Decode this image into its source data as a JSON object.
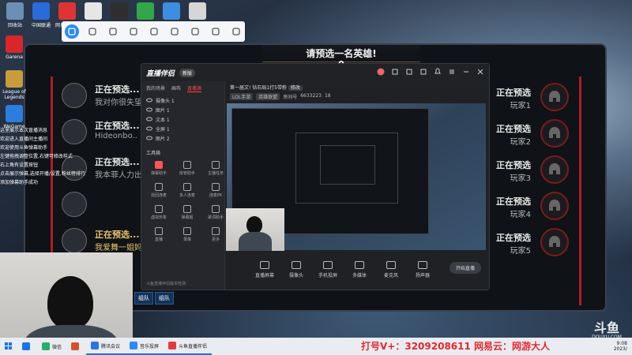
{
  "desktop": {
    "icons_top": [
      {
        "label": "回收站",
        "color": "#6b8fb5"
      },
      {
        "label": "中国联通",
        "color": "#2a6ad9"
      },
      {
        "label": "网易云音乐",
        "color": "#e03434"
      },
      {
        "label": "",
        "color": "#e6e6e6"
      },
      {
        "label": "",
        "color": "#2e2e2e"
      },
      {
        "label": "",
        "color": "#33a64a"
      },
      {
        "label": "",
        "color": "#3b8ee0"
      },
      {
        "label": "",
        "color": "#d6d6d6"
      }
    ],
    "icons_left": [
      {
        "label": "Garena",
        "color": "#d8262b"
      },
      {
        "label": "League of Legends",
        "color": "#c89b3c"
      },
      {
        "label": "WeGame",
        "color": "#2b7de0"
      }
    ]
  },
  "toolbar": {
    "buttons": [
      {
        "name": "user-icon",
        "active": true
      },
      {
        "name": "fullscreen-icon",
        "active": false
      },
      {
        "name": "camera-icon",
        "active": false
      },
      {
        "name": "screenshot-icon",
        "active": false
      },
      {
        "name": "screen-icon",
        "active": false
      },
      {
        "name": "brush-icon",
        "active": false
      },
      {
        "name": "grid-icon",
        "active": false
      },
      {
        "name": "gear-icon",
        "active": false
      },
      {
        "name": "headset-icon",
        "active": false
      }
    ]
  },
  "game": {
    "title": "请预选一名英雄!",
    "timer": "0",
    "left_team": [
      {
        "status": "正在预选...",
        "name": "我对你很失望Q",
        "highlight": false
      },
      {
        "status": "正在预选...",
        "name": "Hideonbo..",
        "highlight": false
      },
      {
        "status": "正在预选...",
        "name": "我本菲人力出...",
        "highlight": false
      },
      {
        "status": "",
        "name": "",
        "highlight": false
      },
      {
        "status": "正在预选...",
        "name": "我爱舞一姐妈",
        "highlight": true
      }
    ],
    "right_team": [
      {
        "status": "正在预选",
        "name": "玩家1"
      },
      {
        "status": "正在预选",
        "name": "玩家2"
      },
      {
        "status": "正在预选",
        "name": "玩家3"
      },
      {
        "status": "正在预选",
        "name": "玩家4"
      },
      {
        "status": "正在预选",
        "name": "玩家5"
      }
    ],
    "bottom_tabs": [
      "组队",
      "组队"
    ]
  },
  "chat": {
    "lines": [
      "这里展示本次直播消息",
      "欢迎<b>进入</b>直播间主播间",
      "",
      "",
      "欢迎使用斗鱼弹幕助手",
      "左键拖拽调整位置,右键可修改样式",
      "",
      "右上角有设置按钮",
      "点击展示弹幕,选择开播/设置,粉丝榜排行",
      "",
      "添加弹幕助手成功"
    ]
  },
  "app": {
    "logo": "直播伴侣",
    "version": "新版",
    "sidebar_tabs": [
      "我的场景",
      "画布",
      "直播源"
    ],
    "scene_items": [
      "摄像头 1",
      "图片 1",
      "文本 1",
      "全屏 1",
      "图片 2"
    ],
    "tools_title": "工具箱",
    "tools": [
      {
        "label": "弹幕助手",
        "red": true
      },
      {
        "label": "房管助手",
        "red": false
      },
      {
        "label": "主播任务",
        "red": false
      },
      {
        "label": "找回连麦",
        "red": false
      },
      {
        "label": "多人连麦",
        "red": false
      },
      {
        "label": "连麦PK",
        "red": false
      },
      {
        "label": "虚拟形象",
        "red": false
      },
      {
        "label": "弹幕姬",
        "red": false
      },
      {
        "label": "歌词助手",
        "red": false
      },
      {
        "label": "直播",
        "red": false
      },
      {
        "label": "录像",
        "red": false
      },
      {
        "label": "更多",
        "red": false
      }
    ],
    "stream_title": "第一届文! 钻石局1打5带粉",
    "stream_edit": "修改",
    "stream_meta": [
      "LOL手游",
      "英雄联盟",
      "房间号",
      "6633223",
      "18"
    ],
    "bottom_actions": [
      "直播屏幕",
      "摄像头",
      "手机投屏",
      "多媒体",
      "麦克风",
      "扬声器"
    ],
    "go_live": "开始直播",
    "status": "斗鱼直播伴侣版本检测"
  },
  "taskbar": {
    "apps": [
      {
        "label": "",
        "color": "#1a73e8",
        "open": false
      },
      {
        "label": "微信",
        "color": "#2aae67",
        "open": false
      },
      {
        "label": "",
        "color": "#d94f2b",
        "open": false
      },
      {
        "label": "腾讯会议",
        "color": "#2b73e3",
        "open": true
      },
      {
        "label": "音乐投屏",
        "color": "#2b8cf2",
        "open": true
      },
      {
        "label": "斗鱼直播伴侣",
        "color": "#e23b3b",
        "open": true
      }
    ],
    "clock_time": "9:08",
    "clock_date": "2023/"
  },
  "watermark": "打号V+：3209208611  网易云：网游大人",
  "brand": {
    "big": "斗鱼",
    "small": "DOUYU.COM"
  }
}
